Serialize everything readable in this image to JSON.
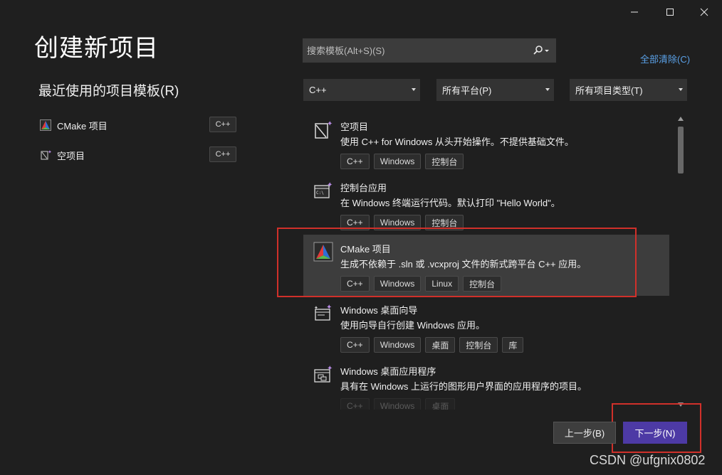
{
  "window": {
    "controls": [
      "minimize",
      "maximize",
      "close"
    ]
  },
  "page": {
    "title": "创建新项目"
  },
  "recent": {
    "title": "最近使用的项目模板(R)",
    "items": [
      {
        "name": "CMake 项目",
        "lang": "C++",
        "icon": "cmake-icon"
      },
      {
        "name": "空项目",
        "lang": "C++",
        "icon": "empty-project-icon"
      }
    ]
  },
  "search": {
    "placeholder": "搜索模板(Alt+S)(S)",
    "value": ""
  },
  "clear_all": "全部清除(C)",
  "filters": {
    "language": "C++",
    "platform": "所有平台(P)",
    "project_type": "所有项目类型(T)"
  },
  "templates": [
    {
      "title": "空项目",
      "desc": "使用 C++ for Windows 从头开始操作。不提供基础文件。",
      "tags": [
        "C++",
        "Windows",
        "控制台"
      ],
      "icon": "empty-project-icon"
    },
    {
      "title": "控制台应用",
      "desc": "在 Windows 终端运行代码。默认打印 \"Hello World\"。",
      "tags": [
        "C++",
        "Windows",
        "控制台"
      ],
      "icon": "console-app-icon"
    },
    {
      "title": "CMake 项目",
      "desc": "生成不依赖于 .sln 或 .vcxproj 文件的新式跨平台 C++ 应用。",
      "tags": [
        "C++",
        "Windows",
        "Linux",
        "控制台"
      ],
      "icon": "cmake-icon",
      "selected": true
    },
    {
      "title": "Windows 桌面向导",
      "desc": "使用向导自行创建 Windows 应用。",
      "tags": [
        "C++",
        "Windows",
        "桌面",
        "控制台",
        "库"
      ],
      "icon": "desktop-wizard-icon"
    },
    {
      "title": "Windows 桌面应用程序",
      "desc": "具有在 Windows 上运行的图形用户界面的应用程序的项目。",
      "tags": [
        "C++",
        "Windows",
        "桌面"
      ],
      "icon": "desktop-app-icon"
    }
  ],
  "buttons": {
    "back": "上一步(B)",
    "next": "下一步(N)"
  },
  "colors": {
    "accent": "#4d3aa5",
    "link": "#5aa0e6",
    "highlight": "#d0302a"
  },
  "watermark": "CSDN @ufgnix0802"
}
